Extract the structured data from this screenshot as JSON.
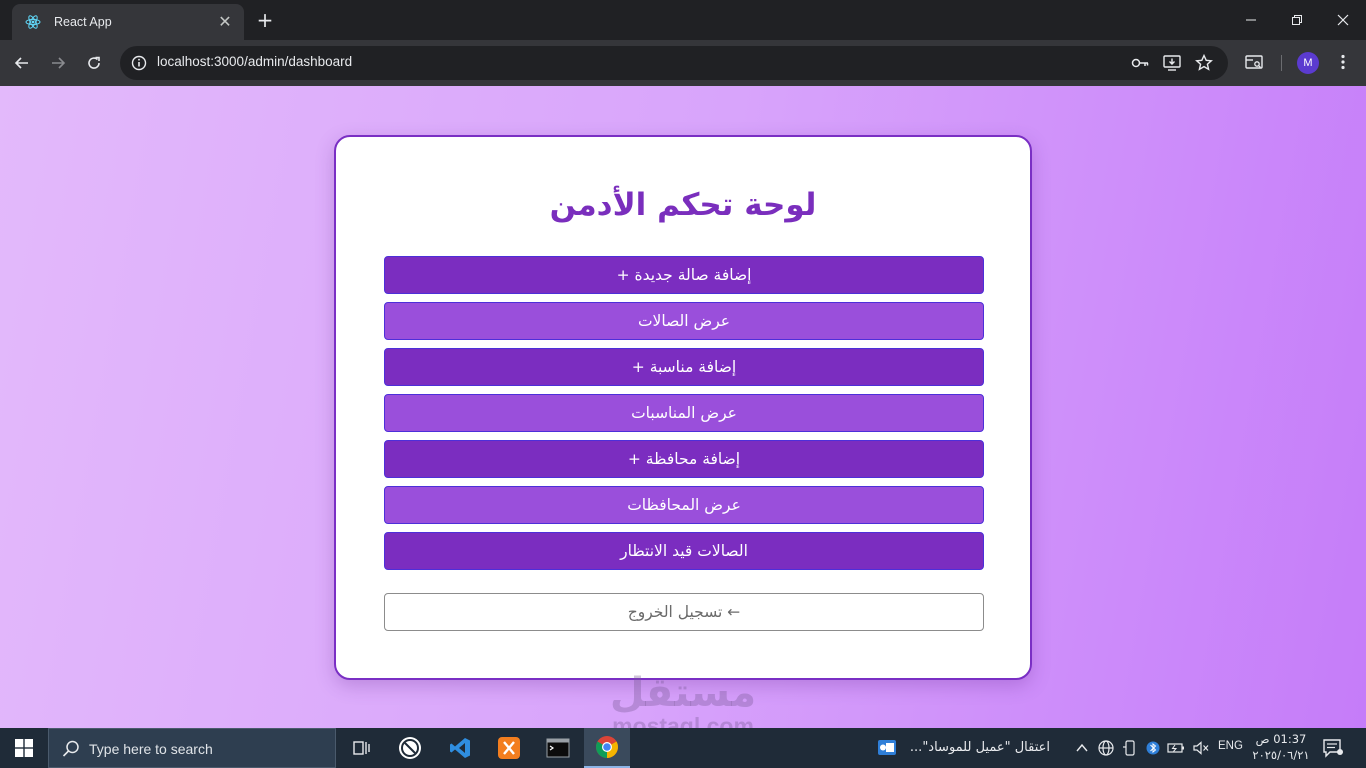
{
  "browser": {
    "tab_title": "React App",
    "url": "localhost:3000/admin/dashboard",
    "profile_initial": "M",
    "icons": [
      "react-favicon",
      "close-icon",
      "plus-icon",
      "minimize-icon",
      "restore-icon",
      "close-window-icon",
      "back-icon",
      "forward-icon",
      "reload-icon",
      "info-icon",
      "key-icon",
      "install-icon",
      "star-icon",
      "tab-search-icon",
      "menu-kebab-icon"
    ]
  },
  "dashboard": {
    "title": "لوحة تحكم الأدمن",
    "buttons": [
      {
        "label": "إضافة صالة جديدة +",
        "style": "dark"
      },
      {
        "label": "عرض الصالات",
        "style": "light"
      },
      {
        "label": "إضافة مناسبة +",
        "style": "dark"
      },
      {
        "label": "عرض المناسبات",
        "style": "light"
      },
      {
        "label": "إضافة محافظة +",
        "style": "dark"
      },
      {
        "label": "عرض المحافظات",
        "style": "light"
      },
      {
        "label": "الصالات قيد الانتظار",
        "style": "dark"
      }
    ],
    "logout_label": "← تسجيل الخروج",
    "colors": {
      "title": "#7a2ebd",
      "button_dark": "#7b2dc0",
      "button_light": "#9a4fdb",
      "button_border": "#4d2fd9",
      "background_start": "#e3b9fb",
      "background_end": "#c57cf9"
    }
  },
  "watermark": {
    "arabic": "مستقل",
    "latin": "mostaql.com"
  },
  "taskbar": {
    "search_placeholder": "Type here to search",
    "notification_text": "اعتقال \"عميل للموساد\"...",
    "language": "ENG",
    "time": "01:37 ص",
    "date": "٢٠٢٥/٠٦/٢١"
  }
}
